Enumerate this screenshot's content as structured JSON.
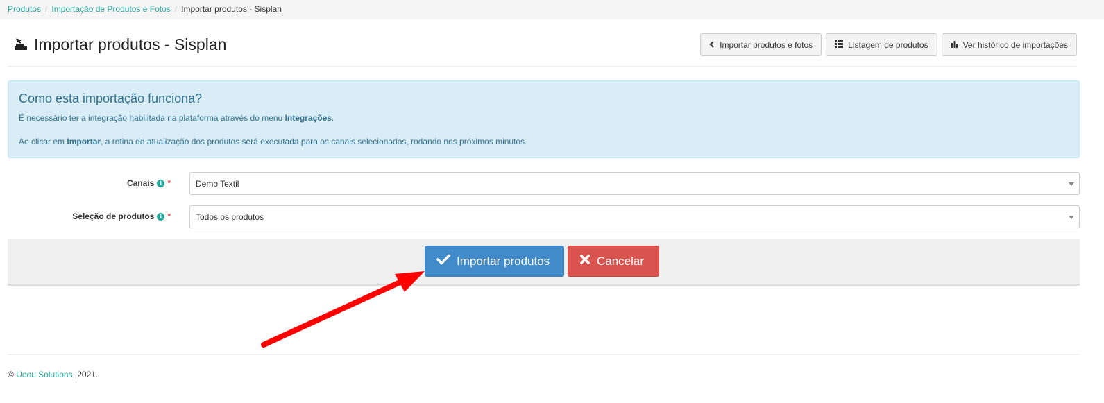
{
  "breadcrumb": {
    "items": [
      "Produtos",
      "Importação de Produtos e Fotos"
    ],
    "current": "Importar produtos - Sisplan",
    "separator": "/"
  },
  "header": {
    "title": "Importar produtos - Sisplan",
    "icon": "import-icon",
    "buttons": {
      "back": "Importar produtos e fotos",
      "list": "Listagem de produtos",
      "history": "Ver histórico de importações"
    }
  },
  "alert": {
    "title": "Como esta importação funciona?",
    "line1_prefix": "É necessário ter a integração habilitada na plataforma através do menu ",
    "line1_bold": "Integrações",
    "line1_suffix": ".",
    "line2_prefix": "Ao clicar em ",
    "line2_bold": "Importar",
    "line2_suffix": ", a rotina de atualização dos produtos será executada para os canais selecionados, rodando nos próximos minutos."
  },
  "form": {
    "canais": {
      "label": "Canais",
      "value": "Demo Textil"
    },
    "selecao": {
      "label": "Seleção de produtos",
      "value": "Todos os produtos"
    },
    "required_mark": "*",
    "info_glyph": "i"
  },
  "actions": {
    "submit_label": "Importar produtos",
    "cancel_label": "Cancelar"
  },
  "footer": {
    "copyright": "©",
    "company": "Uoou Solutions",
    "year_text": ", 2021."
  },
  "colors": {
    "accent": "#26a69a",
    "primary": "#428bca",
    "danger": "#d9534f",
    "info_bg": "#d9edf7",
    "annotation_arrow": "#ff0000"
  }
}
